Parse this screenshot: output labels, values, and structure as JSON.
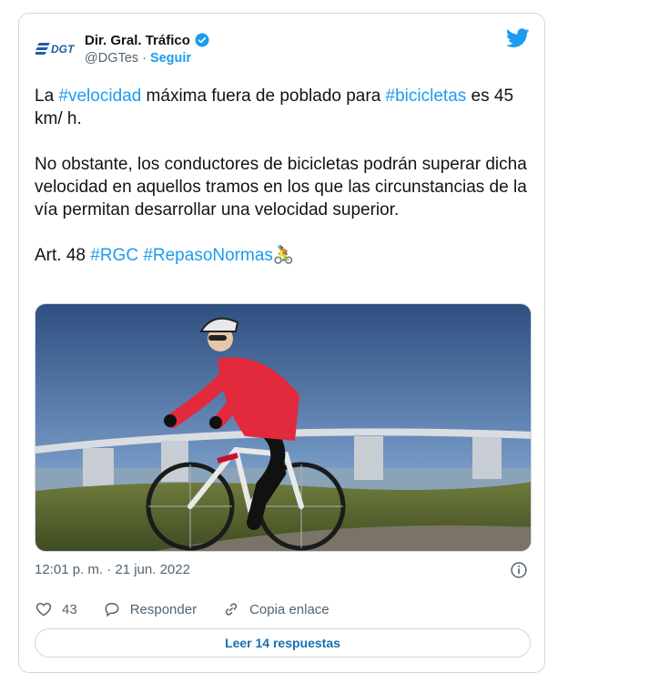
{
  "author": {
    "logo_text": "DGT",
    "name": "Dir. Gral. Tráfico",
    "handle": "@DGTes",
    "separator": " · ",
    "follow_label": "Seguir"
  },
  "tweet": {
    "p1_a": "La ",
    "p1_tag1": "#velocidad",
    "p1_b": " máxima fuera de poblado para ",
    "p1_tag2": "#bicicletas",
    "p1_c": " es 45 km/ h.",
    "p2": "No obstante, los conductores de bicicletas podrán superar dicha velocidad en aquellos tramos en los que las circunstancias de la vía permitan desarrollar una velocidad superior.",
    "p3_a": "Art. 48 ",
    "p3_tag1": "#RGC",
    "p3_tag2": "#RepasoNormas",
    "p3_emoji": "🚴"
  },
  "timestamp": "12:01 p. m. · 21 jun. 2022",
  "actions": {
    "likes": "43",
    "reply_label": "Responder",
    "copy_label": "Copia enlace"
  },
  "read_replies_label": "Leer 14 respuestas",
  "colors": {
    "link": "#1d9bf0",
    "muted": "#536471",
    "border": "#cfd9de"
  }
}
